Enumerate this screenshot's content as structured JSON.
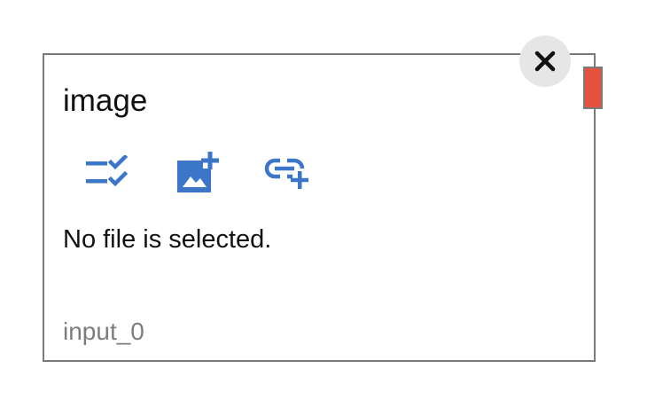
{
  "node": {
    "title": "image",
    "status": "No file is selected.",
    "id_label": "input_0"
  },
  "toolbar": {
    "items": [
      {
        "icon": "checklist-icon"
      },
      {
        "icon": "add-photo-icon"
      },
      {
        "icon": "add-link-icon"
      }
    ]
  },
  "colors": {
    "icon_blue": "#3b76c9",
    "handle_red": "#e2523d",
    "border_gray": "#7a7a7a",
    "close_bg": "#e6e6e6"
  }
}
